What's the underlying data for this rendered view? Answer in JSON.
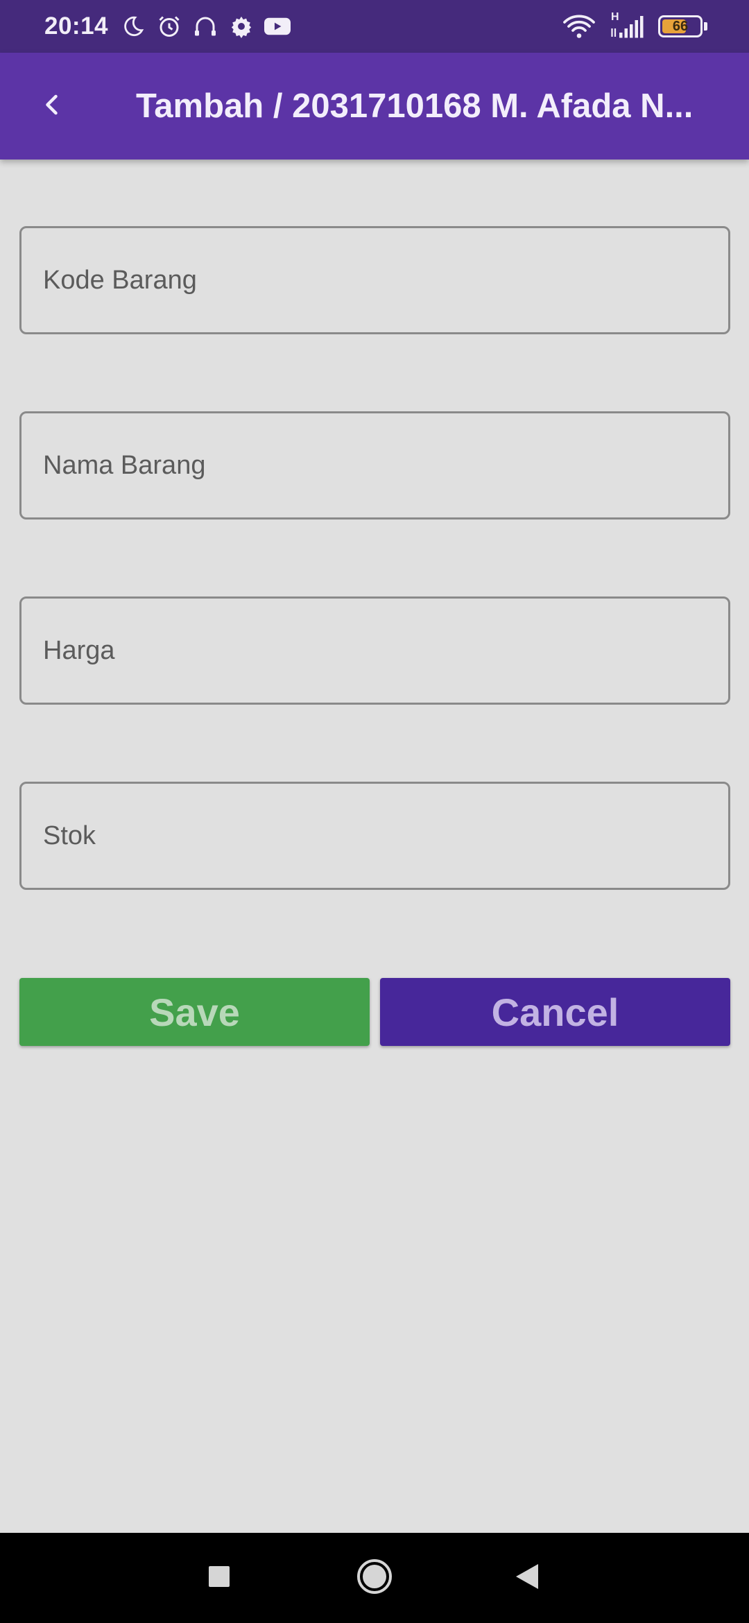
{
  "status_bar": {
    "time": "20:14",
    "left_icons": [
      "moon-icon",
      "alarm-icon",
      "headset-icon",
      "gear-icon",
      "youtube-icon"
    ],
    "right_icons": [
      "wifi-icon",
      "signal-icon",
      "battery-icon"
    ],
    "network_label": "H",
    "battery_level": "66",
    "battery_fraction": 0.66,
    "battery_color": "#e8a23a"
  },
  "app_bar": {
    "back_icon": "chevron-left-icon",
    "title": "Tambah / 2031710168 M. Afada N...",
    "color": "#5c34a6"
  },
  "form": {
    "fields": [
      {
        "placeholder": "Kode Barang",
        "value": ""
      },
      {
        "placeholder": "Nama Barang",
        "value": ""
      },
      {
        "placeholder": "Harga",
        "value": ""
      },
      {
        "placeholder": "Stok",
        "value": ""
      }
    ]
  },
  "actions": {
    "save_label": "Save",
    "save_color": "#43a04b",
    "cancel_label": "Cancel",
    "cancel_color": "#47279a"
  },
  "nav_bar": {
    "icons": [
      "recents-square-icon",
      "home-circle-icon",
      "back-triangle-icon"
    ]
  }
}
